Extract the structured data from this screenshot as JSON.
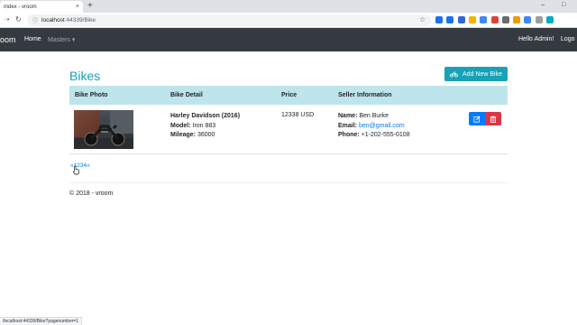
{
  "browser": {
    "tab_title": "Index - vroom",
    "tab_close": "×",
    "new_tab": "+",
    "url_host": "localhost",
    "url_rest": ":44339/Bike",
    "status_url": "/localhost:44339/Bike?pagenumber=1",
    "window_minimize": "–",
    "window_maximize": "□",
    "extension_colors": [
      "#1a73e8",
      "#1a73e8",
      "#3367d6",
      "#f4b400",
      "#4285f4",
      "#db4437",
      "#6c6c6c",
      "#f29900",
      "#4285f4",
      "#9e9e9e",
      "#00acc1"
    ]
  },
  "site": {
    "brand": "oom",
    "nav_home": "Home",
    "nav_masters": "Masters",
    "greeting": "Hello Admin!",
    "logout": "Logo"
  },
  "page": {
    "title": "Bikes",
    "add_button": "Add New Bike",
    "columns": [
      "Bike Photo",
      "Bike Detail",
      "Price",
      "Seller Information"
    ],
    "row": {
      "name": "Harley Davidson (2016)",
      "model_label": "Model:",
      "model": "Iron 883",
      "mileage_label": "Mileage:",
      "mileage": "36000",
      "price": "12338 USD",
      "seller_name_label": "Name:",
      "seller_name": "Ben Burke",
      "seller_email_label": "Email:",
      "seller_email": "ben@gmail.com",
      "seller_phone_label": "Phone:",
      "seller_phone": "+1-202-555-0108"
    },
    "pagination": "«1234»",
    "footer": "© 2018 - vroom"
  },
  "colors": {
    "accent": "#17a2b8",
    "navbar": "#343a40",
    "table_header": "#bee5eb",
    "edit": "#007bff",
    "delete": "#dc3545"
  }
}
